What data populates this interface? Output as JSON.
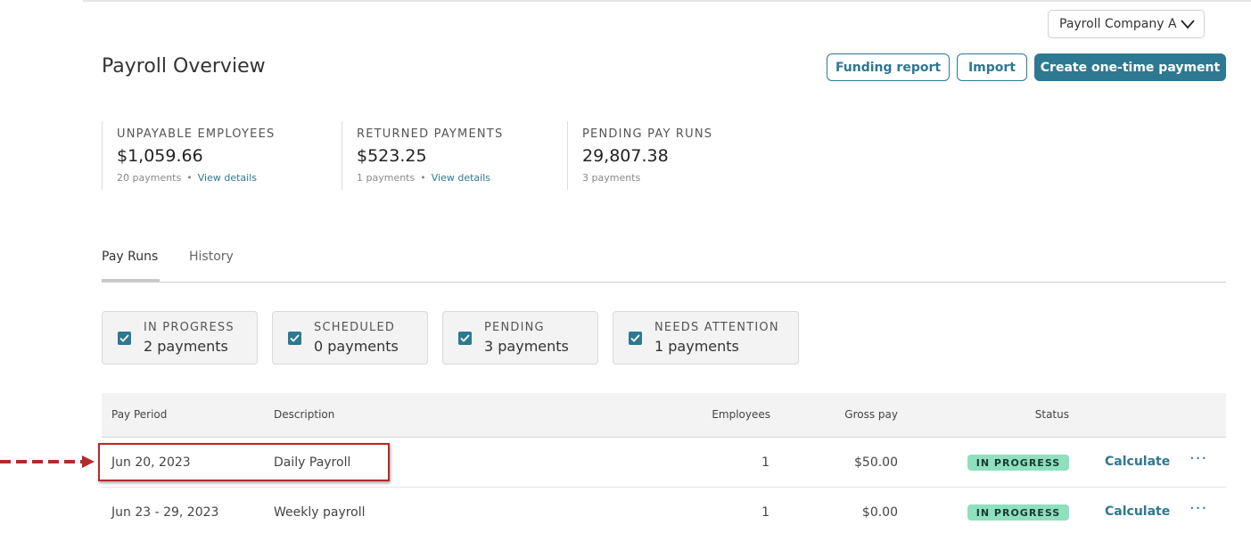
{
  "company_select": {
    "value": "Payroll Company A"
  },
  "header": {
    "title": "Payroll Overview",
    "funding_report_label": "Funding report",
    "import_label": "Import",
    "create_payment_label": "Create one-time payment"
  },
  "stats": [
    {
      "label": "UNPAYABLE EMPLOYEES",
      "value": "$1,059.66",
      "count": "20 payments",
      "link": "View details"
    },
    {
      "label": "RETURNED PAYMENTS",
      "value": "$523.25",
      "count": "1 payments",
      "link": "View details"
    },
    {
      "label": "PENDING PAY RUNS",
      "value": "29,807.38",
      "count": "3 payments",
      "link": ""
    }
  ],
  "tabs": [
    {
      "label": "Pay Runs",
      "active": true
    },
    {
      "label": "History",
      "active": false
    }
  ],
  "filters": [
    {
      "label": "IN PROGRESS",
      "value": "2 payments",
      "checked": true
    },
    {
      "label": "SCHEDULED",
      "value": "0 payments",
      "checked": true
    },
    {
      "label": "PENDING",
      "value": "3 payments",
      "checked": true
    },
    {
      "label": "NEEDS ATTENTION",
      "value": "1 payments",
      "checked": true
    }
  ],
  "table": {
    "headers": {
      "pay_period": "Pay Period",
      "description": "Description",
      "employees": "Employees",
      "gross_pay": "Gross pay",
      "status": "Status"
    },
    "rows": [
      {
        "pay_period": "Jun 20, 2023",
        "description": "Daily Payroll",
        "employees": "1",
        "gross_pay": "$50.00",
        "status": "IN PROGRESS",
        "action": "Calculate",
        "more": "···"
      },
      {
        "pay_period": "Jun 23 - 29, 2023",
        "description": "Weekly payroll",
        "employees": "1",
        "gross_pay": "$0.00",
        "status": "IN PROGRESS",
        "action": "Calculate",
        "more": "···"
      }
    ]
  },
  "colors": {
    "accent": "#2e7891",
    "badge_in_progress": "#8ee0bf",
    "annotation_red": "#b52a2a"
  }
}
